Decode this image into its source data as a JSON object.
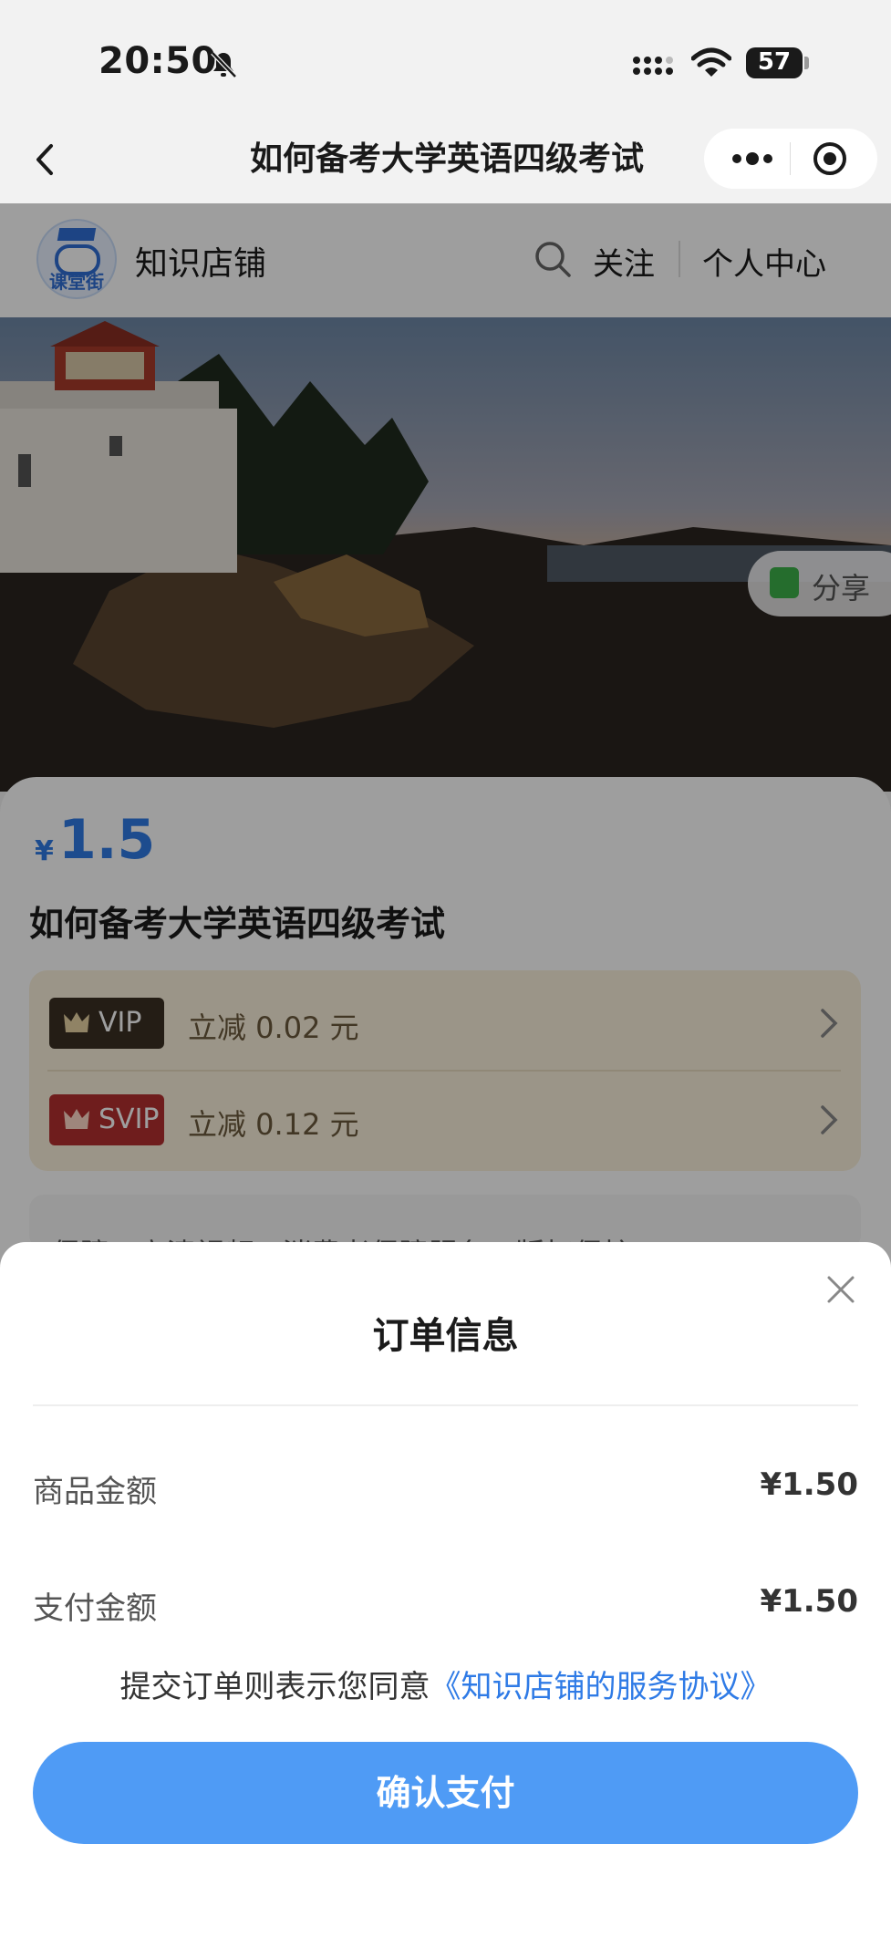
{
  "status_bar": {
    "time": "20:50",
    "battery": "57"
  },
  "nav": {
    "title": "如何备考大学英语四级考试"
  },
  "shop": {
    "logo_text": "课堂街",
    "name": "知识店铺",
    "follow": "关注",
    "personal_center": "个人中心"
  },
  "hero": {
    "share": "分享"
  },
  "product": {
    "currency": "¥",
    "price": "1.5",
    "title": "如何备考大学英语四级考试",
    "vip": {
      "badge": "VIP",
      "text": "立减 0.02 元"
    },
    "svip": {
      "badge": "SVIP",
      "text": "立减 0.12 元"
    },
    "guarantee": "保障 · 高清视频 / 消费者保障服务 / 版权保护"
  },
  "order_sheet": {
    "title": "订单信息",
    "item_amount_label": "商品金额",
    "item_amount": "¥1.50",
    "pay_amount_label": "支付金额",
    "pay_amount": "¥1.50",
    "agreement_prefix": "提交订单则表示您同意",
    "agreement_link": "《知识店铺的服务协议》",
    "confirm_button": "确认支付"
  },
  "colors": {
    "accent": "#4f9bf5",
    "price": "#2f7be6",
    "vip_dark": "#3a2f22",
    "svip_red": "#b3302f"
  }
}
